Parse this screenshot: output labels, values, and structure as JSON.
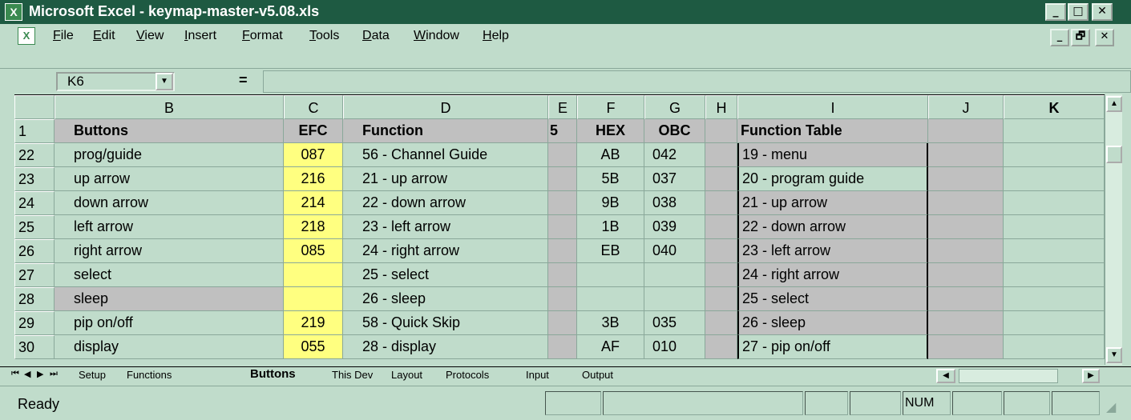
{
  "window": {
    "title": "Microsoft Excel - keymap-master-v5.08.xls",
    "minimize": "_",
    "maximize": "□",
    "close": "✕",
    "doc_minimize": "_",
    "doc_restore": "🗗",
    "doc_close": "✕"
  },
  "menu": [
    "File",
    "Edit",
    "View",
    "Insert",
    "Format",
    "Tools",
    "Data",
    "Window",
    "Help"
  ],
  "formula_bar": {
    "name_box": "K6",
    "equals": "=",
    "formula": ""
  },
  "columns": [
    "B",
    "C",
    "D",
    "E",
    "F",
    "G",
    "H",
    "I",
    "J",
    "K"
  ],
  "header_row": {
    "row": "1",
    "B": "Buttons",
    "C": "EFC",
    "D": "Function",
    "E": "5",
    "F": "HEX",
    "G": "OBC",
    "H": "",
    "I": "Function Table",
    "J": "",
    "K": ""
  },
  "rows": [
    {
      "row": "22",
      "B": "prog/guide",
      "C": "087",
      "D": "56 - Channel Guide",
      "F": "AB",
      "G": "042",
      "I": "19 - menu"
    },
    {
      "row": "23",
      "B": "up arrow",
      "C": "216",
      "D": "21 - up arrow",
      "F": "5B",
      "G": "037",
      "I": "20 - program guide"
    },
    {
      "row": "24",
      "B": "down arrow",
      "C": "214",
      "D": "22 - down arrow",
      "F": "9B",
      "G": "038",
      "I": "21 - up arrow"
    },
    {
      "row": "25",
      "B": "left arrow",
      "C": "218",
      "D": "23 - left arrow",
      "F": "1B",
      "G": "039",
      "I": "22 - down arrow"
    },
    {
      "row": "26",
      "B": "right arrow",
      "C": "085",
      "D": "24 - right arrow",
      "F": "EB",
      "G": "040",
      "I": "23 - left arrow"
    },
    {
      "row": "27",
      "B": "select",
      "C": "",
      "D": "25 - select",
      "F": "",
      "G": "",
      "I": "24 - right arrow"
    },
    {
      "row": "28",
      "B": "sleep",
      "C": "",
      "D": "26 - sleep",
      "F": "",
      "G": "",
      "I": "25 - select"
    },
    {
      "row": "29",
      "B": "pip on/off",
      "C": "219",
      "D": "58 - Quick Skip",
      "F": "3B",
      "G": "035",
      "I": "26 - sleep"
    },
    {
      "row": "30",
      "B": "display",
      "C": "055",
      "D": "28 - display",
      "F": "AF",
      "G": "010",
      "I": "27 - pip on/off"
    }
  ],
  "sheet_tabs": [
    "Setup",
    "Functions",
    "Buttons",
    "This Dev",
    "Layout",
    "Protocols",
    "Input",
    "Output"
  ],
  "active_tab": "Buttons",
  "status": {
    "text": "Ready",
    "num": "NUM"
  },
  "colors": {
    "title_bar": "#1e5a42",
    "window_bg": "#c0dccb",
    "efc_fill": "#ffff80",
    "grey_fill": "#c0c0c0"
  }
}
